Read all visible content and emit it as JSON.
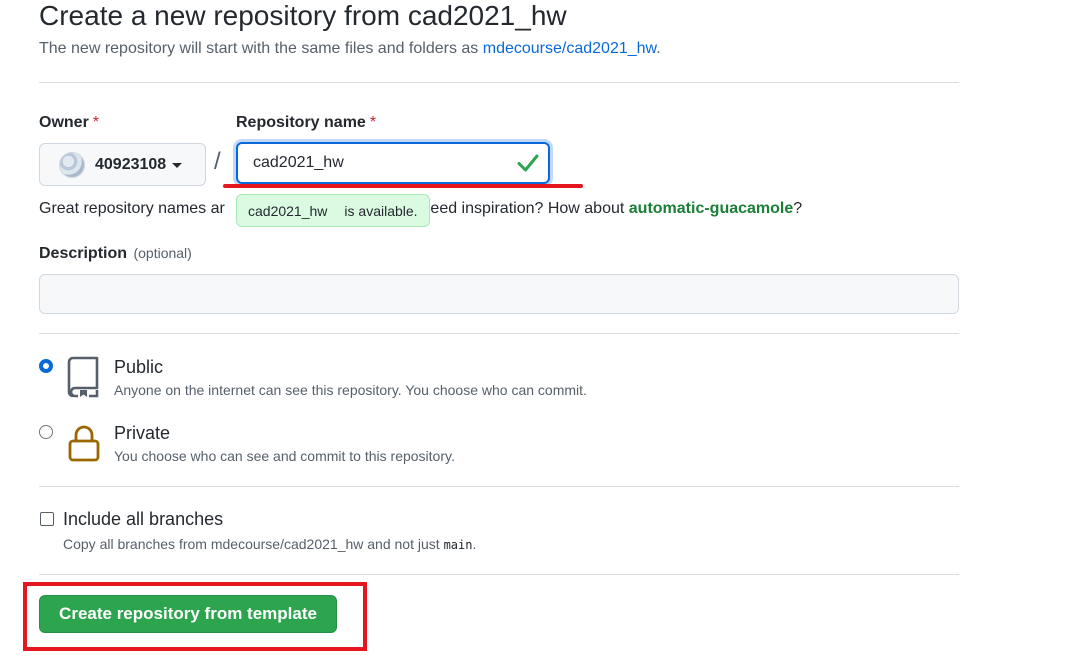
{
  "header": {
    "title": "Create a new repository from cad2021_hw",
    "subtitle_prefix": "The new repository will start with the same files and folders as ",
    "template_link": "mdecourse/cad2021_hw",
    "subtitle_suffix": "."
  },
  "owner": {
    "label": "Owner",
    "required_mark": "*",
    "selected": "40923108"
  },
  "separator": "/",
  "repo_name": {
    "label": "Repository name",
    "required_mark": "*",
    "value": "cad2021_hw",
    "valid": true
  },
  "availability": {
    "hint_prefix": "Great repository names ar",
    "hint_middle": "Need inspiration? How about ",
    "suggestion": "automatic-guacamole",
    "hint_suffix": "?",
    "badge_name": "cad2021_hw",
    "badge_text": "is available."
  },
  "description": {
    "label": "Description",
    "optional": "(optional)",
    "value": ""
  },
  "visibility": {
    "selected": "public",
    "options": [
      {
        "title": "Public",
        "desc": "Anyone on the internet can see this repository. You choose who can commit."
      },
      {
        "title": "Private",
        "desc": "You choose who can see and commit to this repository."
      }
    ]
  },
  "branches": {
    "title": "Include all branches",
    "desc_prefix": "Copy all branches from mdecourse/cad2021_hw and not just ",
    "desc_code": "main",
    "desc_suffix": ".",
    "checked": false
  },
  "submit": {
    "label": "Create repository from template"
  },
  "colors": {
    "accent": "#0969da",
    "primary_button": "#2da44e",
    "success_text": "#1a7f37",
    "highlight_annotation": "#e5161e",
    "private_icon": "#9a6700"
  },
  "icons": {
    "public": "repo-icon",
    "private": "lock-icon",
    "valid": "check-icon"
  }
}
